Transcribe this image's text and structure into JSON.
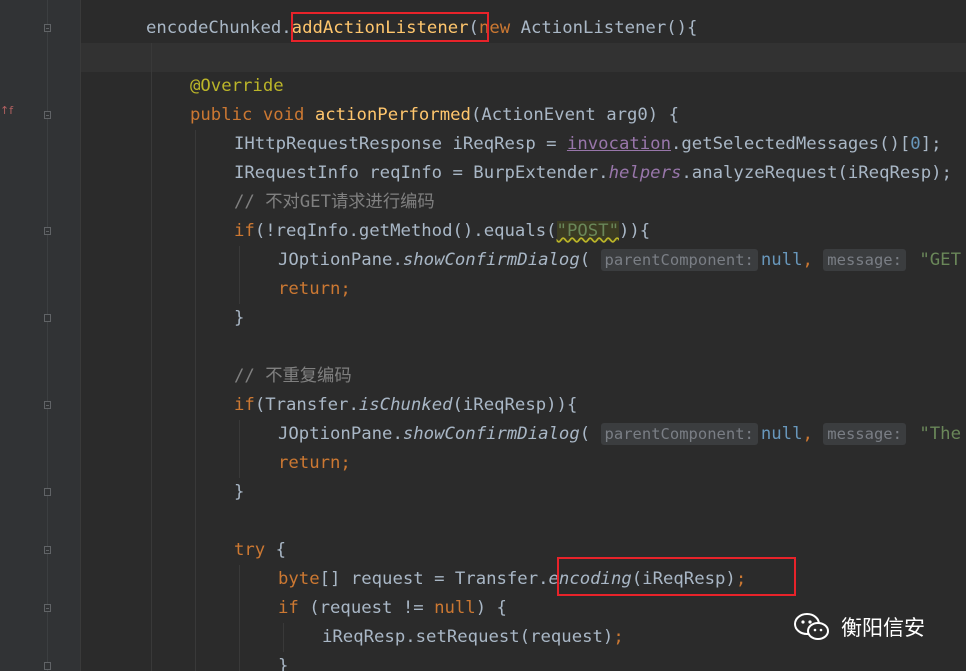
{
  "code_lines": [
    {
      "indent": 0,
      "tokens": [
        [
          "id",
          "encodeChunked"
        ],
        [
          "id",
          "."
        ],
        [
          "mth",
          "addActionListener"
        ],
        [
          "id",
          "("
        ],
        [
          "kw",
          "new "
        ],
        [
          "id",
          "ActionListener(){"
        ]
      ]
    },
    {
      "indent": 0,
      "tokens": []
    },
    {
      "indent": 1,
      "tokens": [
        [
          "ann",
          "@Override"
        ]
      ]
    },
    {
      "indent": 1,
      "tokens": [
        [
          "kw",
          "public void "
        ],
        [
          "mth",
          "actionPerformed"
        ],
        [
          "id",
          "(ActionEvent arg0) {"
        ]
      ]
    },
    {
      "indent": 2,
      "tokens": [
        [
          "id",
          "IHttpRequestResponse iReqResp = "
        ],
        [
          "ufld",
          "invocation"
        ],
        [
          "id",
          ".getSelectedMessages()["
        ],
        [
          "num",
          "0"
        ],
        [
          "id",
          "];"
        ]
      ]
    },
    {
      "indent": 2,
      "tokens": [
        [
          "id",
          "IRequestInfo reqInfo = BurpExtender."
        ],
        [
          "fld",
          "helpers"
        ],
        [
          "id",
          ".analyzeRequest(iReqResp);"
        ]
      ]
    },
    {
      "indent": 2,
      "tokens": [
        [
          "cmt",
          "// 不对GET请求进行编码"
        ]
      ]
    },
    {
      "indent": 2,
      "tokens": [
        [
          "kw",
          "if"
        ],
        [
          "id",
          "(!reqInfo.getMethod().equals("
        ],
        [
          "str",
          "\"POST\""
        ],
        [
          "id",
          "))"
        ],
        [
          "id",
          "{"
        ]
      ]
    },
    {
      "indent": 3,
      "tokens": [
        [
          "id",
          "JOptionPane."
        ],
        [
          "stat",
          "showConfirmDialog"
        ],
        [
          "id",
          "( "
        ],
        [
          "hint",
          "parentComponent:"
        ],
        [
          "nullkw",
          "null"
        ],
        [
          "kw",
          ", "
        ],
        [
          "hint",
          "message:"
        ],
        [
          "str2",
          " \"GET"
        ]
      ]
    },
    {
      "indent": 3,
      "tokens": [
        [
          "kw",
          "return;"
        ]
      ]
    },
    {
      "indent": 2,
      "tokens": [
        [
          "id",
          "}"
        ]
      ]
    },
    {
      "indent": 0,
      "tokens": []
    },
    {
      "indent": 2,
      "tokens": [
        [
          "cmt",
          "// 不重复编码"
        ]
      ]
    },
    {
      "indent": 2,
      "tokens": [
        [
          "kw",
          "if"
        ],
        [
          "id",
          "(Transfer."
        ],
        [
          "stat",
          "isChunked"
        ],
        [
          "id",
          "(iReqResp)){"
        ]
      ]
    },
    {
      "indent": 3,
      "tokens": [
        [
          "id",
          "JOptionPane."
        ],
        [
          "stat",
          "showConfirmDialog"
        ],
        [
          "id",
          "( "
        ],
        [
          "hint",
          "parentComponent:"
        ],
        [
          "nullkw",
          "null"
        ],
        [
          "kw",
          ", "
        ],
        [
          "hint",
          "message:"
        ],
        [
          "str2",
          " \"The"
        ]
      ]
    },
    {
      "indent": 3,
      "tokens": [
        [
          "kw",
          "return;"
        ]
      ]
    },
    {
      "indent": 2,
      "tokens": [
        [
          "id",
          "}"
        ]
      ]
    },
    {
      "indent": 0,
      "tokens": []
    },
    {
      "indent": 2,
      "tokens": [
        [
          "kw",
          "try "
        ],
        [
          "id",
          "{"
        ]
      ]
    },
    {
      "indent": 3,
      "tokens": [
        [
          "kw",
          "byte"
        ],
        [
          "id",
          "[] request = Transfer."
        ],
        [
          "stat",
          "encoding"
        ],
        [
          "id",
          "(iReqResp)"
        ],
        [
          "kw",
          ";"
        ]
      ]
    },
    {
      "indent": 3,
      "tokens": [
        [
          "kw",
          "if "
        ],
        [
          "id",
          "(request != "
        ],
        [
          "kw",
          "null"
        ],
        [
          "id",
          ") {"
        ]
      ]
    },
    {
      "indent": 4,
      "tokens": [
        [
          "id",
          "iReqResp.setRequest(request)"
        ],
        [
          "kw",
          ";"
        ]
      ]
    },
    {
      "indent": 3,
      "tokens": [
        [
          "id",
          "}"
        ]
      ]
    }
  ],
  "watermark": {
    "label": "衡阳信安"
  }
}
